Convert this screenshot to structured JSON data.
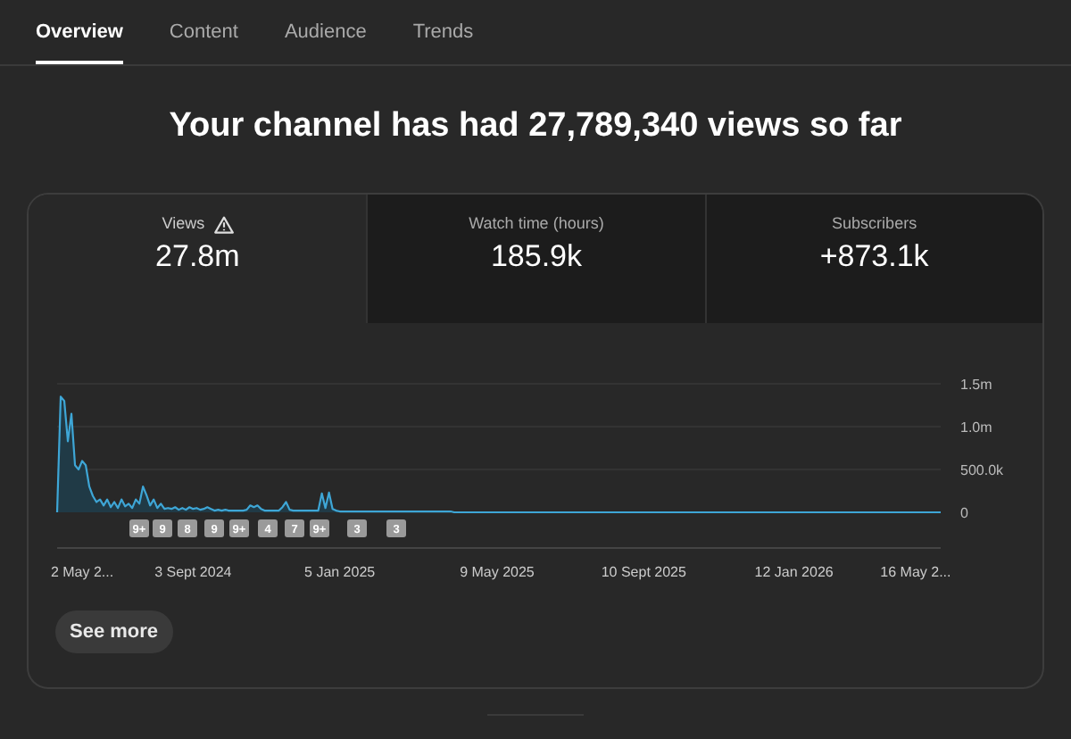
{
  "tabs": [
    {
      "label": "Overview",
      "selected": true
    },
    {
      "label": "Content",
      "selected": false
    },
    {
      "label": "Audience",
      "selected": false
    },
    {
      "label": "Trends",
      "selected": false
    }
  ],
  "headline": "Your channel has had 27,789,340 views so far",
  "metrics": [
    {
      "label": "Views",
      "value": "27.8m",
      "warning": true,
      "selected": true
    },
    {
      "label": "Watch time (hours)",
      "value": "185.9k",
      "warning": false,
      "selected": false
    },
    {
      "label": "Subscribers",
      "value": "+873.1k",
      "warning": false,
      "selected": false
    }
  ],
  "chart": {
    "chart_data": {
      "type": "line",
      "categories": [
        null,
        null,
        null,
        null,
        null,
        null,
        null,
        "2 May 2...",
        null,
        null,
        null,
        null,
        null,
        null,
        null,
        null,
        null,
        null,
        null,
        null,
        null,
        null,
        null,
        null,
        null,
        null,
        null,
        null,
        null,
        null,
        null,
        null,
        null,
        null,
        null,
        null,
        null,
        null,
        "3 Sept 2024",
        null,
        null,
        null,
        null,
        null,
        null,
        null,
        null,
        null,
        null,
        null,
        null,
        null,
        null,
        null,
        null,
        null,
        null,
        null,
        null,
        null,
        null,
        null,
        null,
        null,
        null,
        null,
        null,
        null,
        null,
        null,
        null,
        null,
        null,
        null,
        null,
        null,
        null,
        null,
        null,
        "5 Jan 2025",
        null,
        null,
        null,
        null,
        null,
        null,
        null,
        null,
        null,
        null,
        null,
        null,
        null,
        null,
        null,
        null,
        null,
        null,
        null,
        null,
        null,
        null,
        null,
        null,
        null,
        null,
        null,
        null,
        null,
        null,
        null,
        null,
        null,
        null,
        null,
        null,
        null,
        null,
        null,
        null,
        null,
        null,
        null,
        "9 May 2025",
        null,
        null,
        null,
        null,
        null,
        null,
        null,
        null,
        null,
        null,
        null,
        null,
        null,
        null,
        null,
        null,
        null,
        null,
        null,
        null,
        null,
        null,
        null,
        null,
        null,
        null,
        null,
        null,
        null,
        null,
        null,
        null,
        null,
        null,
        null,
        null,
        null,
        null,
        null,
        null,
        "10 Sept 2025",
        null,
        null,
        null,
        null,
        null,
        null,
        null,
        null,
        null,
        null,
        null,
        null,
        null,
        null,
        null,
        null,
        null,
        null,
        null,
        null,
        null,
        null,
        null,
        null,
        null,
        null,
        null,
        null,
        null,
        null,
        null,
        null,
        null,
        null,
        null,
        null,
        null,
        null,
        null,
        null,
        null,
        "12 Jan 2026",
        null,
        null,
        null,
        null,
        null,
        null,
        null,
        null,
        null,
        null,
        null,
        null,
        null,
        null,
        null,
        null,
        null,
        null,
        null,
        null,
        null,
        null,
        null,
        null,
        null,
        null,
        null,
        null,
        null,
        null,
        null,
        null,
        null,
        "16 May 2...",
        null,
        null,
        null,
        null,
        null,
        null,
        null
      ],
      "series": [
        {
          "color": "#3ea6d6",
          "values": [
            0,
            1350000,
            1300000,
            830000,
            1150000,
            550000,
            500000,
            600000,
            550000,
            300000,
            190000,
            120000,
            150000,
            80000,
            150000,
            60000,
            120000,
            50000,
            150000,
            70000,
            100000,
            50000,
            150000,
            100000,
            300000,
            200000,
            80000,
            150000,
            50000,
            100000,
            40000,
            50000,
            40000,
            60000,
            30000,
            50000,
            30000,
            60000,
            40000,
            50000,
            30000,
            40000,
            60000,
            40000,
            20000,
            30000,
            20000,
            30000,
            20000,
            20000,
            20000,
            20000,
            20000,
            30000,
            80000,
            60000,
            80000,
            40000,
            20000,
            20000,
            20000,
            20000,
            20000,
            60000,
            120000,
            30000,
            20000,
            20000,
            20000,
            20000,
            20000,
            20000,
            20000,
            20000,
            220000,
            50000,
            230000,
            40000,
            20000,
            10000,
            10000,
            10000,
            10000,
            10000,
            10000,
            10000,
            10000,
            10000,
            10000,
            10000,
            10000,
            10000,
            10000,
            10000,
            10000,
            10000,
            10000,
            10000,
            10000,
            10000,
            10000,
            10000,
            10000,
            10000,
            10000,
            10000,
            10000,
            10000,
            10000,
            10000,
            10000,
            0,
            0,
            0,
            0,
            0,
            0,
            0,
            0,
            0,
            0,
            0,
            0,
            0,
            0,
            0,
            0,
            0,
            0,
            0,
            0,
            0,
            0,
            0,
            0,
            0,
            0,
            0,
            0,
            0,
            0,
            0,
            0,
            0,
            0,
            0,
            0,
            0,
            0,
            0,
            0,
            0,
            0,
            0,
            0,
            0,
            0,
            0,
            0,
            0,
            0,
            0,
            0,
            0,
            0,
            0,
            0,
            0,
            0,
            0,
            0,
            0,
            0,
            0,
            0,
            0,
            0,
            0,
            0,
            0,
            0,
            0,
            0,
            0,
            0,
            0,
            0,
            0,
            0,
            0,
            0,
            0,
            0,
            0,
            0,
            0,
            0,
            0,
            0,
            0,
            0,
            0,
            0,
            0,
            0,
            0,
            0,
            0,
            0,
            0,
            0,
            0,
            0,
            0,
            0,
            0,
            0,
            0,
            0,
            0,
            0,
            0,
            0,
            0,
            0,
            0,
            0,
            0,
            0,
            0,
            0,
            0,
            0,
            0,
            0,
            0,
            0,
            0,
            0,
            0,
            0,
            0,
            0,
            0,
            0,
            0,
            0,
            0
          ]
        }
      ],
      "ylim": [
        0,
        1500000
      ],
      "yticks": [
        {
          "value": 0,
          "label": "0"
        },
        {
          "value": 500000,
          "label": "500.0k"
        },
        {
          "value": 1000000,
          "label": "1.0m"
        },
        {
          "value": 1500000,
          "label": "1.5m"
        }
      ],
      "annotations": [
        "9+",
        "9",
        "8",
        "9",
        "9+",
        "4",
        "7",
        "9+",
        "3",
        "3"
      ]
    }
  },
  "see_more_button": "See more"
}
